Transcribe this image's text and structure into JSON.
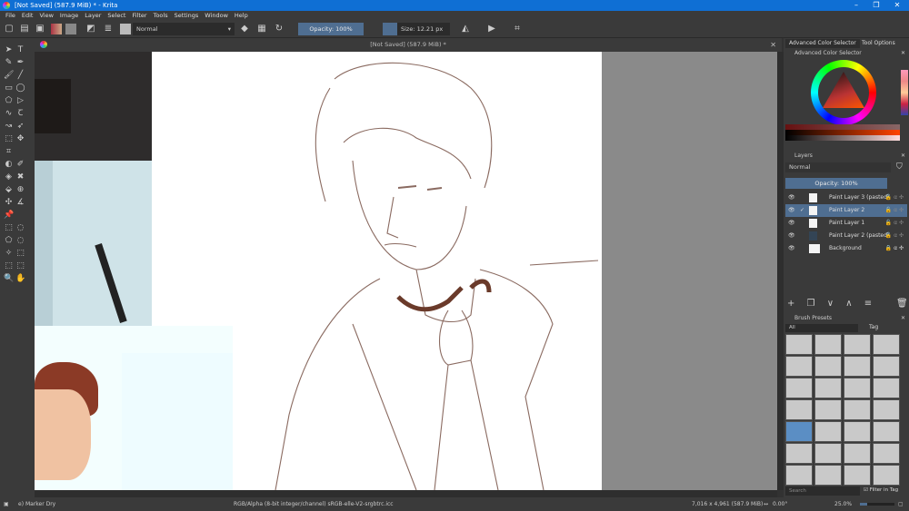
{
  "window": {
    "title": "[Not Saved]  (587.9 MiB) * - Krita"
  },
  "menu": [
    "File",
    "Edit",
    "View",
    "Image",
    "Layer",
    "Select",
    "Filter",
    "Tools",
    "Settings",
    "Window",
    "Help"
  ],
  "toolbar": {
    "blend_mode": "Normal",
    "opacity_label": "Opacity: 100%",
    "opacity": 100,
    "size_label": "Size: 12.21 px",
    "size": 12.21
  },
  "document": {
    "tab_title": "[Not Saved]  (587.9 MiB) *"
  },
  "dock": {
    "tabs": [
      "Advanced Color Selector",
      "Tool Options"
    ],
    "color_selector_title": "Advanced Color Selector",
    "layers_title": "Layers",
    "layers_blend": "Normal",
    "layers_opacity_label": "Opacity:  100%",
    "layers": [
      {
        "name": "Paint Layer 3 (pasted)",
        "visible": true,
        "selected": false
      },
      {
        "name": "Paint Layer 2",
        "visible": true,
        "selected": true
      },
      {
        "name": "Paint Layer 1",
        "visible": true,
        "selected": false
      },
      {
        "name": "Paint Layer 2 (pasted)",
        "visible": true,
        "selected": false
      },
      {
        "name": "Background",
        "visible": true,
        "selected": false,
        "locked": true
      }
    ],
    "brush_presets_title": "Brush Presets",
    "brush_filter": "All",
    "brush_tag_label": "Tag",
    "search_placeholder": "Search",
    "filter_in_tag": "Filter in Tag"
  },
  "status": {
    "brush": "e) Marker Dry",
    "color_space": "RGB/Alpha (8-bit integer/channel)  sRGB-elle-V2-srgbtrc.icc",
    "image_size": "7,016 x 4,961 (587.9 MiB)",
    "rotation": "0.00°",
    "zoom": "25.0%"
  },
  "colors": {
    "title_bar": "#0f6fd4",
    "accent": "#4f6e91",
    "panel": "#3a3a3a"
  }
}
